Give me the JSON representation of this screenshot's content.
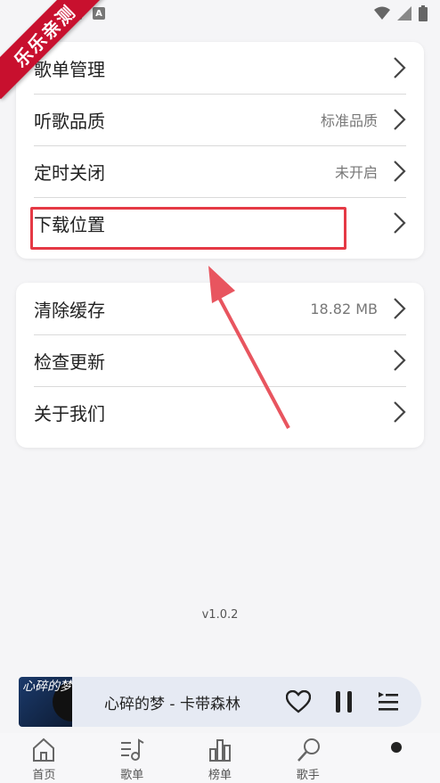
{
  "status_bar": {
    "left_icons": [
      "app-square-icon",
      "a-letter-icon"
    ],
    "a_letter": "A",
    "right_icons": [
      "wifi-icon",
      "signal-icon",
      "battery-icon"
    ]
  },
  "watermark": "乐乐亲测",
  "settings_group_1": [
    {
      "label": "歌单管理",
      "value": ""
    },
    {
      "label": "听歌品质",
      "value": "标准品质"
    },
    {
      "label": "定时关闭",
      "value": "未开启"
    },
    {
      "label": "下载位置",
      "value": ""
    }
  ],
  "settings_group_2": [
    {
      "label": "清除缓存",
      "value": "18.82 MB"
    },
    {
      "label": "检查更新",
      "value": ""
    },
    {
      "label": "关于我们",
      "value": ""
    }
  ],
  "version": "v1.0.2",
  "player": {
    "song": "心碎的梦 - 卡带森林",
    "album_text": "心碎的梦"
  },
  "tabs": [
    {
      "label": "首页",
      "icon": "home-icon"
    },
    {
      "label": "歌单",
      "icon": "playlist-icon"
    },
    {
      "label": "榜单",
      "icon": "chart-icon"
    },
    {
      "label": "歌手",
      "icon": "singer-icon"
    },
    {
      "label": "",
      "icon": "dot-icon"
    }
  ],
  "colors": {
    "highlight": "#e53945",
    "background": "#f5f5f7",
    "player_bg": "#e6eaf3"
  }
}
